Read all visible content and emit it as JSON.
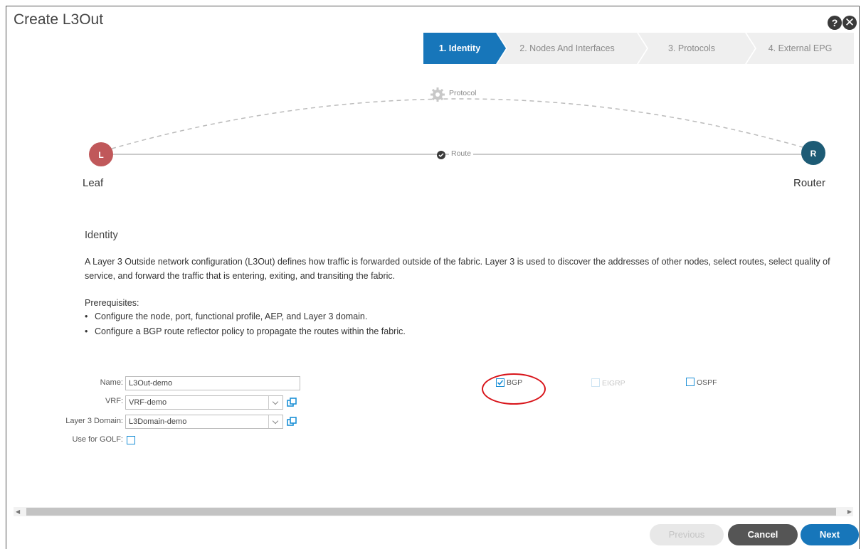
{
  "dialog": {
    "title": "Create L3Out",
    "help_icon": "?",
    "close_icon": "✕"
  },
  "wizard": {
    "steps": [
      {
        "label": "1. Identity",
        "active": true
      },
      {
        "label": "2. Nodes And Interfaces",
        "active": false
      },
      {
        "label": "3. Protocols",
        "active": false
      },
      {
        "label": "4. External EPG",
        "active": false
      }
    ]
  },
  "topology": {
    "leaf": {
      "letter": "L",
      "label": "Leaf",
      "color": "#c0585a"
    },
    "router": {
      "letter": "R",
      "label": "Router",
      "color": "#1d5b75"
    },
    "protocol_label": "Protocol",
    "route_label": "Route"
  },
  "identity": {
    "title": "Identity",
    "description": "A Layer 3 Outside network configuration (L3Out) defines how traffic is forwarded outside of the fabric. Layer 3 is used to discover the addresses of other nodes, select routes, select quality of service, and forward the traffic that is entering, exiting, and transiting the fabric.",
    "prereq_title": "Prerequisites:",
    "prereqs": [
      "Configure the node, port, functional profile, AEP, and Layer 3 domain.",
      "Configure a BGP route reflector policy to propagate the routes within the fabric."
    ]
  },
  "form": {
    "name_label": "Name:",
    "name_value": "L3Out-demo",
    "vrf_label": "VRF:",
    "vrf_value": "VRF-demo",
    "domain_label": "Layer 3 Domain:",
    "domain_value": "L3Domain-demo",
    "golf_label": "Use for GOLF:",
    "golf_checked": false
  },
  "protocols": {
    "bgp": {
      "label": "BGP",
      "checked": true,
      "enabled": true
    },
    "eigrp": {
      "label": "EIGRP",
      "checked": false,
      "enabled": false
    },
    "ospf": {
      "label": "OSPF",
      "checked": false,
      "enabled": true
    }
  },
  "footer": {
    "previous": "Previous",
    "cancel": "Cancel",
    "next": "Next"
  },
  "colors": {
    "accent": "#1776ba",
    "highlight": "#d8141a"
  }
}
